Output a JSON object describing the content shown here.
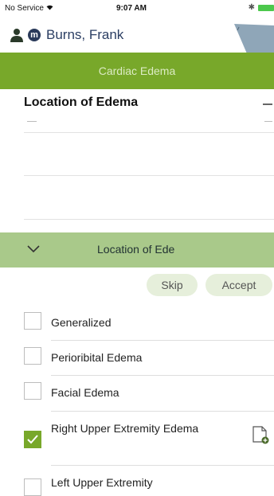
{
  "status": {
    "carrier": "No Service",
    "time": "9:07 AM",
    "bluetooth": "✱"
  },
  "patient": {
    "badge": "m",
    "name": "Burns, Frank"
  },
  "title": "Cardiac Edema",
  "question": {
    "label": "Location of Edema"
  },
  "section": {
    "title": "Location of Ede"
  },
  "buttons": {
    "skip": "Skip",
    "accept": "Accept"
  },
  "options": [
    {
      "label": "Generalized",
      "checked": false
    },
    {
      "label": "Perioribital Edema",
      "checked": false
    },
    {
      "label": "Facial Edema",
      "checked": false
    },
    {
      "label": "Right Upper Extremity Edema",
      "checked": true
    },
    {
      "label": "Left Upper Extremity",
      "checked": false
    }
  ],
  "colors": {
    "primary": "#78a82a",
    "section": "#a9c98a",
    "button_bg": "#e6efdb",
    "name": "#2b3e63"
  }
}
